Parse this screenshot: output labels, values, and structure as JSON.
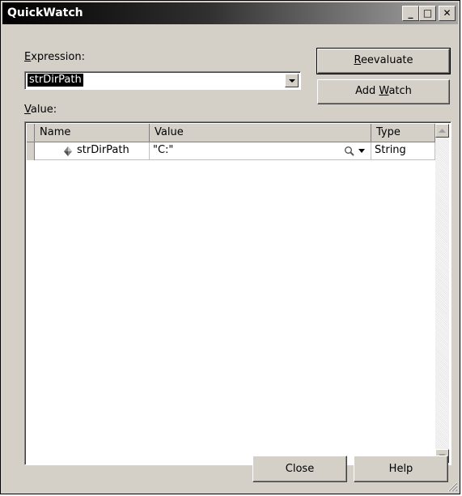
{
  "window": {
    "title": "QuickWatch",
    "minimize_glyph": "_",
    "maximize_glyph": "□",
    "close_glyph": "✕"
  },
  "expression": {
    "label_hotkey": "E",
    "label_rest": "xpression:",
    "value": "strDirPath"
  },
  "value_section": {
    "label_hotkey": "V",
    "label_rest": "alue:"
  },
  "buttons": {
    "reevaluate_hotkey": "R",
    "reevaluate_rest": "eevaluate",
    "addwatch_pre": "Add ",
    "addwatch_hotkey": "W",
    "addwatch_rest": "atch",
    "close": "Close",
    "help": "Help"
  },
  "grid": {
    "columns": [
      "Name",
      "Value",
      "Type"
    ],
    "rows": [
      {
        "name": "strDirPath",
        "value": "\"C:\"",
        "type": "String",
        "icon": "variable-diamond-icon"
      }
    ]
  }
}
